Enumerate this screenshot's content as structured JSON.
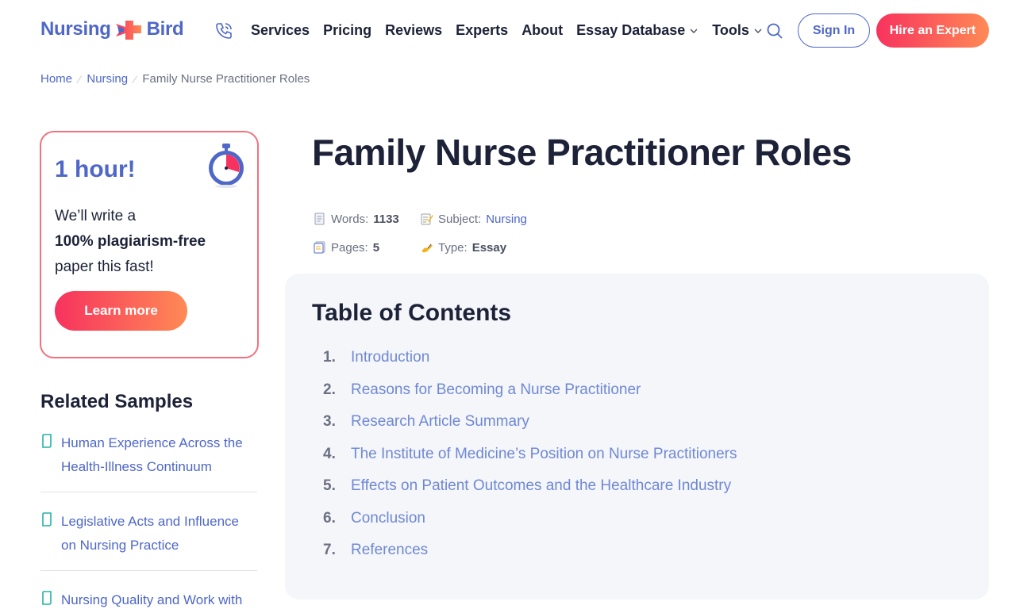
{
  "header": {
    "logo_left": "Nursing",
    "logo_right": "Bird",
    "nav": [
      {
        "label": "Services",
        "dropdown": false
      },
      {
        "label": "Pricing",
        "dropdown": false
      },
      {
        "label": "Reviews",
        "dropdown": false
      },
      {
        "label": "Experts",
        "dropdown": false
      },
      {
        "label": "About",
        "dropdown": false
      },
      {
        "label": "Essay Database",
        "dropdown": true
      },
      {
        "label": "Tools",
        "dropdown": true
      }
    ],
    "signin_label": "Sign In",
    "hire_label": "Hire an Expert"
  },
  "breadcrumb": {
    "home": "Home",
    "category": "Nursing",
    "current": "Family Nurse Practitioner Roles"
  },
  "promo": {
    "headline": "1 hour!",
    "line1": "We’ll write a",
    "line2": "100% plagiarism-free",
    "line3": "paper this fast!",
    "button": "Learn more"
  },
  "related": {
    "title": "Related Samples",
    "items": [
      "Human Experience Across the Health-Illness Continuum",
      "Legislative Acts and Influence on Nursing Practice",
      "Nursing Quality and Work with"
    ]
  },
  "article": {
    "title": "Family Nurse Practitioner Roles",
    "meta": {
      "words_label": "Words:",
      "words_value": "1133",
      "subject_label": "Subject:",
      "subject_value": "Nursing",
      "pages_label": "Pages:",
      "pages_value": "5",
      "type_label": "Type:",
      "type_value": "Essay"
    }
  },
  "toc": {
    "title": "Table of Contents",
    "items": [
      {
        "num": "1.",
        "label": "Introduction"
      },
      {
        "num": "2.",
        "label": "Reasons for Becoming a Nurse Practitioner"
      },
      {
        "num": "3.",
        "label": "Research Article Summary"
      },
      {
        "num": "4.",
        "label": "The Institute of Medicine’s Position on Nurse Practitioners"
      },
      {
        "num": "5.",
        "label": "Effects on Patient Outcomes and the Healthcare Industry"
      },
      {
        "num": "6.",
        "label": "Conclusion"
      },
      {
        "num": "7.",
        "label": "References"
      }
    ]
  },
  "colors": {
    "brand_blue": "#4e67c8",
    "accent_gradient_start": "#f7325e",
    "accent_gradient_end": "#ff8a55",
    "dark_text": "#1d2238",
    "toc_background": "#f4f6fa"
  },
  "icons": [
    "phone-icon",
    "search-icon",
    "chevron-down-icon",
    "stopwatch-icon",
    "document-icon",
    "page-icon",
    "memo-icon",
    "pages-icon",
    "writing-hand-icon"
  ]
}
